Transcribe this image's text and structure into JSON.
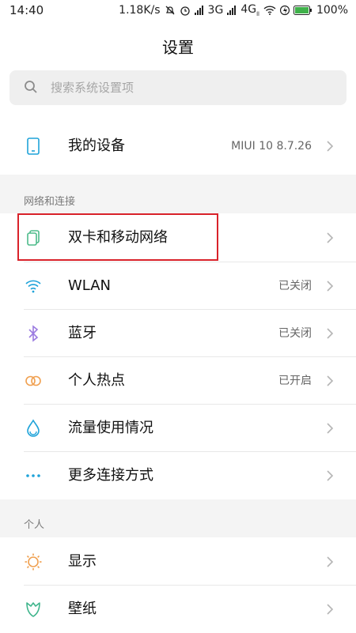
{
  "status_bar": {
    "time": "14:40",
    "speed": "1.18K/s",
    "net_3g": "3G",
    "net_4g": "4G",
    "net_4g_sub": "ll",
    "battery": "100%"
  },
  "header": {
    "title": "设置"
  },
  "search": {
    "placeholder": "搜索系统设置项"
  },
  "device": {
    "label": "我的设备",
    "value": "MIUI 10 8.7.26"
  },
  "sections": {
    "network": "网络和连接",
    "personal": "个人"
  },
  "network_items": [
    {
      "label": "双卡和移动网络",
      "value": ""
    },
    {
      "label": "WLAN",
      "value": "已关闭"
    },
    {
      "label": "蓝牙",
      "value": "已关闭"
    },
    {
      "label": "个人热点",
      "value": "已开启"
    },
    {
      "label": "流量使用情况",
      "value": ""
    },
    {
      "label": "更多连接方式",
      "value": ""
    }
  ],
  "personal_items": [
    {
      "label": "显示",
      "value": ""
    },
    {
      "label": "壁纸",
      "value": ""
    }
  ],
  "colors": {
    "accent_blue": "#1fa3d9",
    "highlight_red": "#d9222a",
    "bluetooth_purple": "#9b7be0",
    "hotspot_orange": "#f0a050",
    "display_orange": "#f0a050",
    "sim_green": "#4dbb8a",
    "wallpaper_green": "#3fb58c"
  }
}
